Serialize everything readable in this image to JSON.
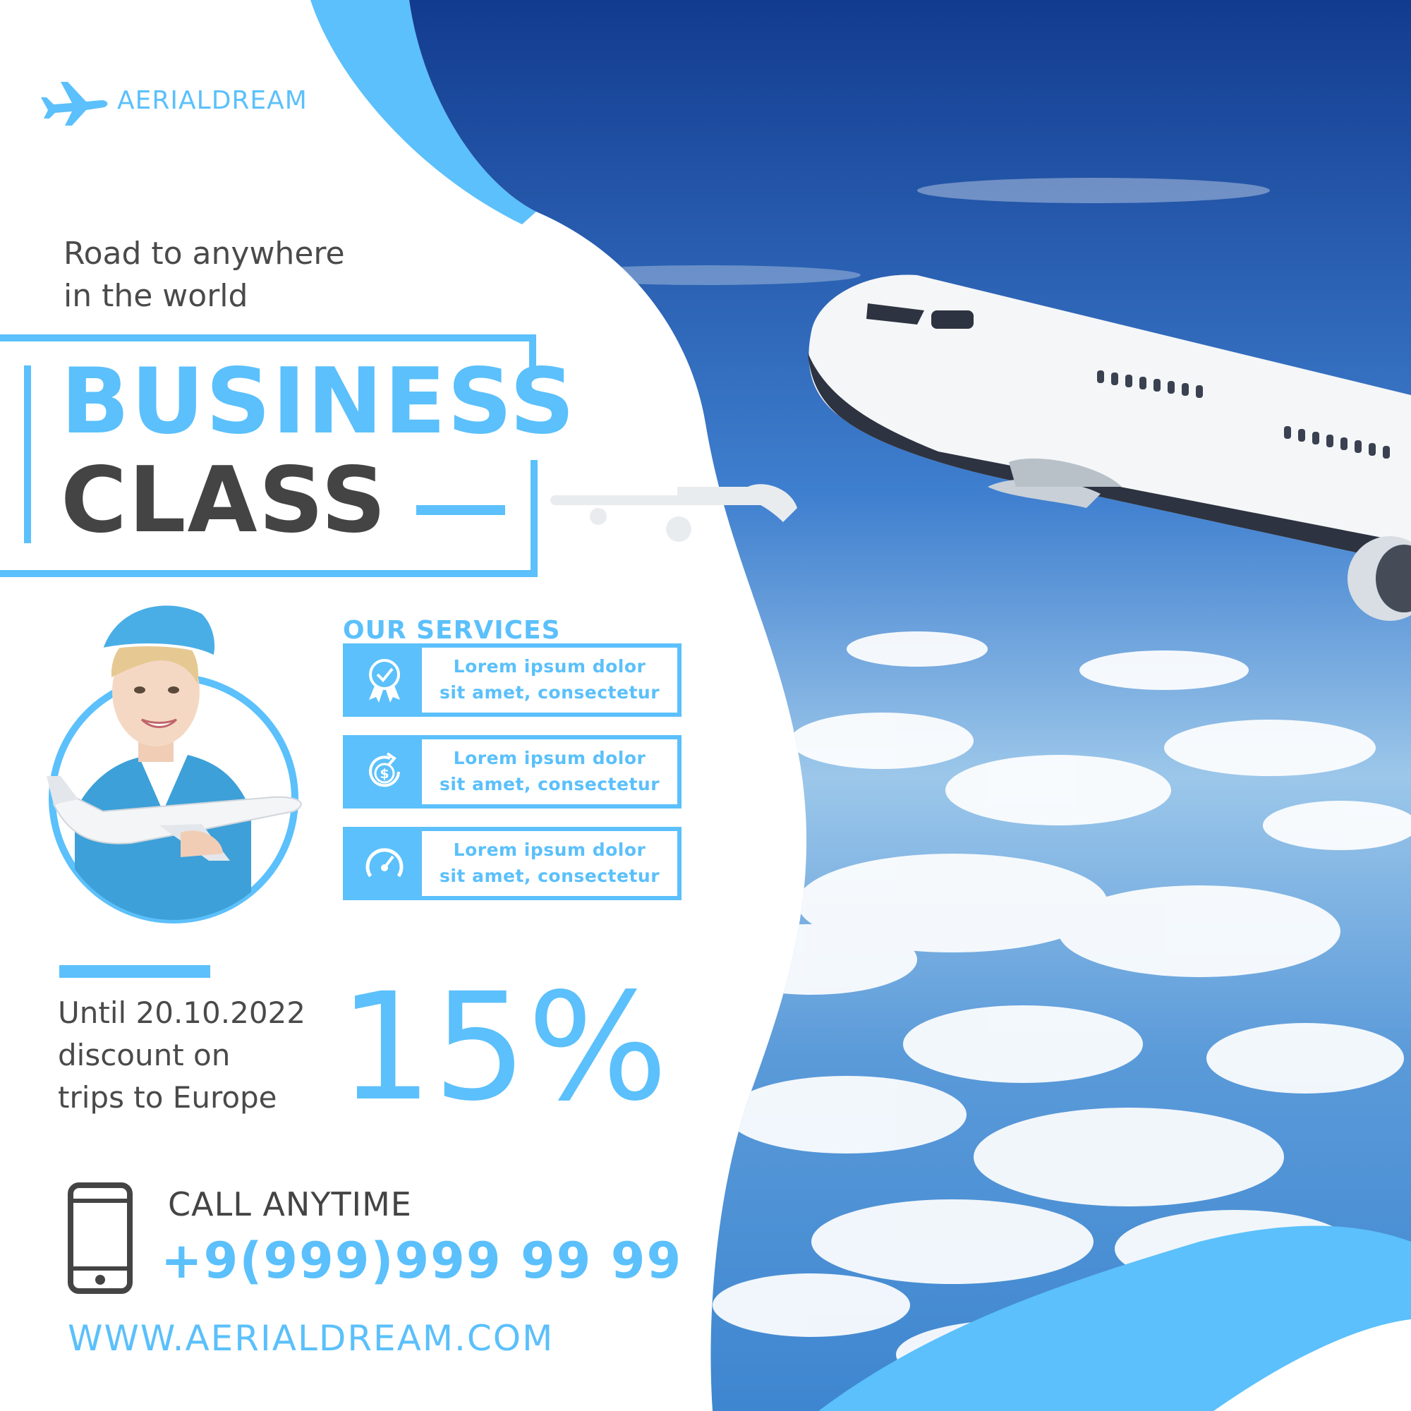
{
  "brand": {
    "name": "AERIALDREAM"
  },
  "tagline": {
    "line1": "Road to anywhere",
    "line2": "in the world"
  },
  "headline": {
    "line1": "BUSINESS",
    "line2": "CLASS"
  },
  "services": {
    "title": "OUR SERVICES",
    "items": [
      {
        "icon": "award-badge-icon",
        "line1": "Lorem ipsum dolor",
        "line2": "sit amet, consectetur"
      },
      {
        "icon": "dollar-refresh-icon",
        "line1": "Lorem ipsum dolor",
        "line2": "sit amet, consectetur"
      },
      {
        "icon": "speedometer-icon",
        "line1": "Lorem ipsum dolor",
        "line2": "sit amet, consectetur"
      }
    ]
  },
  "offer": {
    "line1": "Until 20.10.2022",
    "line2": "discount on",
    "line3": "trips to Europe",
    "discount": "15%"
  },
  "contact": {
    "label": "CALL ANYTIME",
    "phone": "+9(999)999 99 99",
    "website": "WWW.AERIALDREAM.COM"
  },
  "colors": {
    "accent": "#5bc0fb",
    "text_dark": "#444444",
    "sky_top": "#123b8f",
    "sky_bottom": "#4f93d6"
  }
}
